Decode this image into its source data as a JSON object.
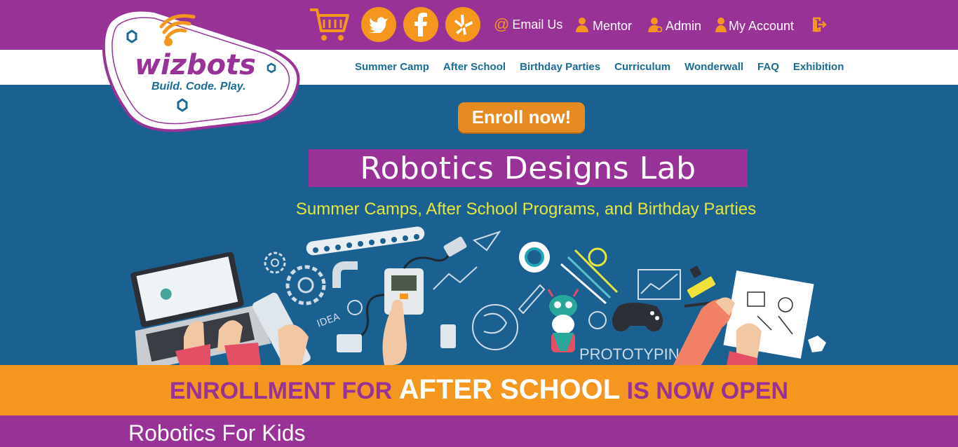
{
  "logo": {
    "wordmark": "wizbots",
    "tagline": "Build. Code. Play."
  },
  "topbar": {
    "email_label": "Email Us",
    "email_symbol": "@",
    "mentor_label": "Mentor",
    "admin_label": "Admin",
    "account_label": "My Account"
  },
  "nav": {
    "items": [
      "Summer Camp",
      "After School",
      "Birthday Parties",
      "Curriculum",
      "Wonderwall",
      "FAQ",
      "Exhibition"
    ]
  },
  "hero": {
    "enroll_label": "Enroll now!",
    "title": "Robotics Designs Lab",
    "subtitle": "Summer Camps, After School Programs, and Birthday Parties",
    "illustration_labels": {
      "idea": "IDEA",
      "prototyping": "PROTOTYPING"
    }
  },
  "banner": {
    "part1": "ENROLLMENT FOR ",
    "part2": "AFTER SCHOOL",
    "part3": " IS NOW OPEN"
  },
  "section": {
    "title": "Robotics For Kids"
  },
  "colors": {
    "purple": "#983297",
    "orange": "#f5961e",
    "hero_blue": "#1a6090",
    "nav_blue": "#1a6b96",
    "subtitle_yellow": "#e6e63c"
  },
  "icons": [
    "cart-icon",
    "twitter-icon",
    "facebook-icon",
    "yelp-icon",
    "mentor-icon",
    "admin-icon",
    "account-icon",
    "logout-icon"
  ]
}
